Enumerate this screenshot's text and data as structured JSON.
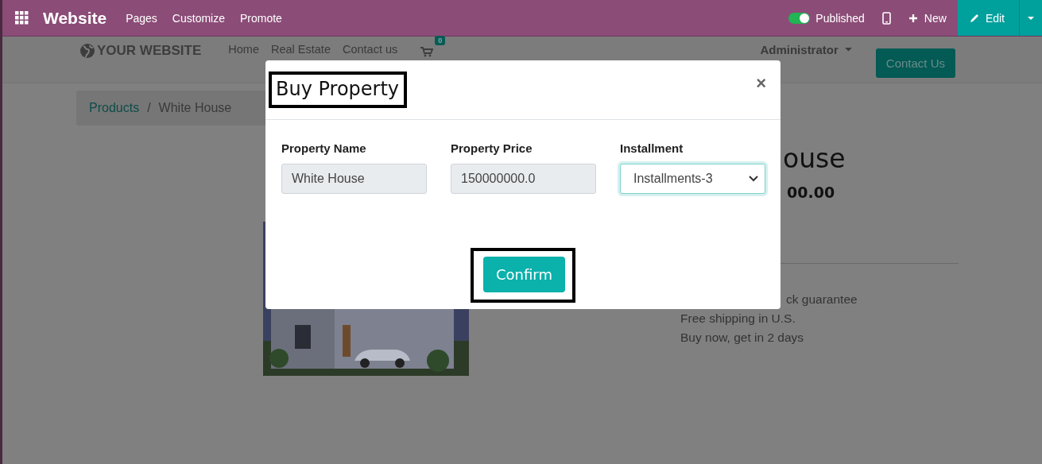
{
  "top_bar": {
    "app_title": "Website",
    "menu": [
      "Pages",
      "Customize",
      "Promote"
    ],
    "published": {
      "label": "Published",
      "on": true
    },
    "new_label": "New",
    "edit_label": "Edit"
  },
  "site_nav": {
    "logo": "YOUR WEBSITE",
    "links": [
      "Home",
      "Real Estate",
      "Contact us"
    ],
    "cart_count": "0",
    "user": "Administrator",
    "contact_button": "Contact Us"
  },
  "breadcrumb": {
    "items": [
      "Products",
      "White House"
    ],
    "separator": "/"
  },
  "product": {
    "title": "ouse",
    "price": "00.00",
    "notes": [
      "ck guarantee",
      "Free shipping in U.S.",
      "Buy now, get in 2 days"
    ]
  },
  "dialog": {
    "title": "Buy Property",
    "close": "×",
    "fields": [
      {
        "kind": "text",
        "label": "Property Name",
        "value": "White House",
        "readonly": true
      },
      {
        "kind": "text",
        "label": "Property Price",
        "value": "150000000.0",
        "readonly": true
      },
      {
        "kind": "select",
        "label": "Installment",
        "value": "Installments-3",
        "readonly": false
      }
    ],
    "confirm": "Confirm"
  }
}
